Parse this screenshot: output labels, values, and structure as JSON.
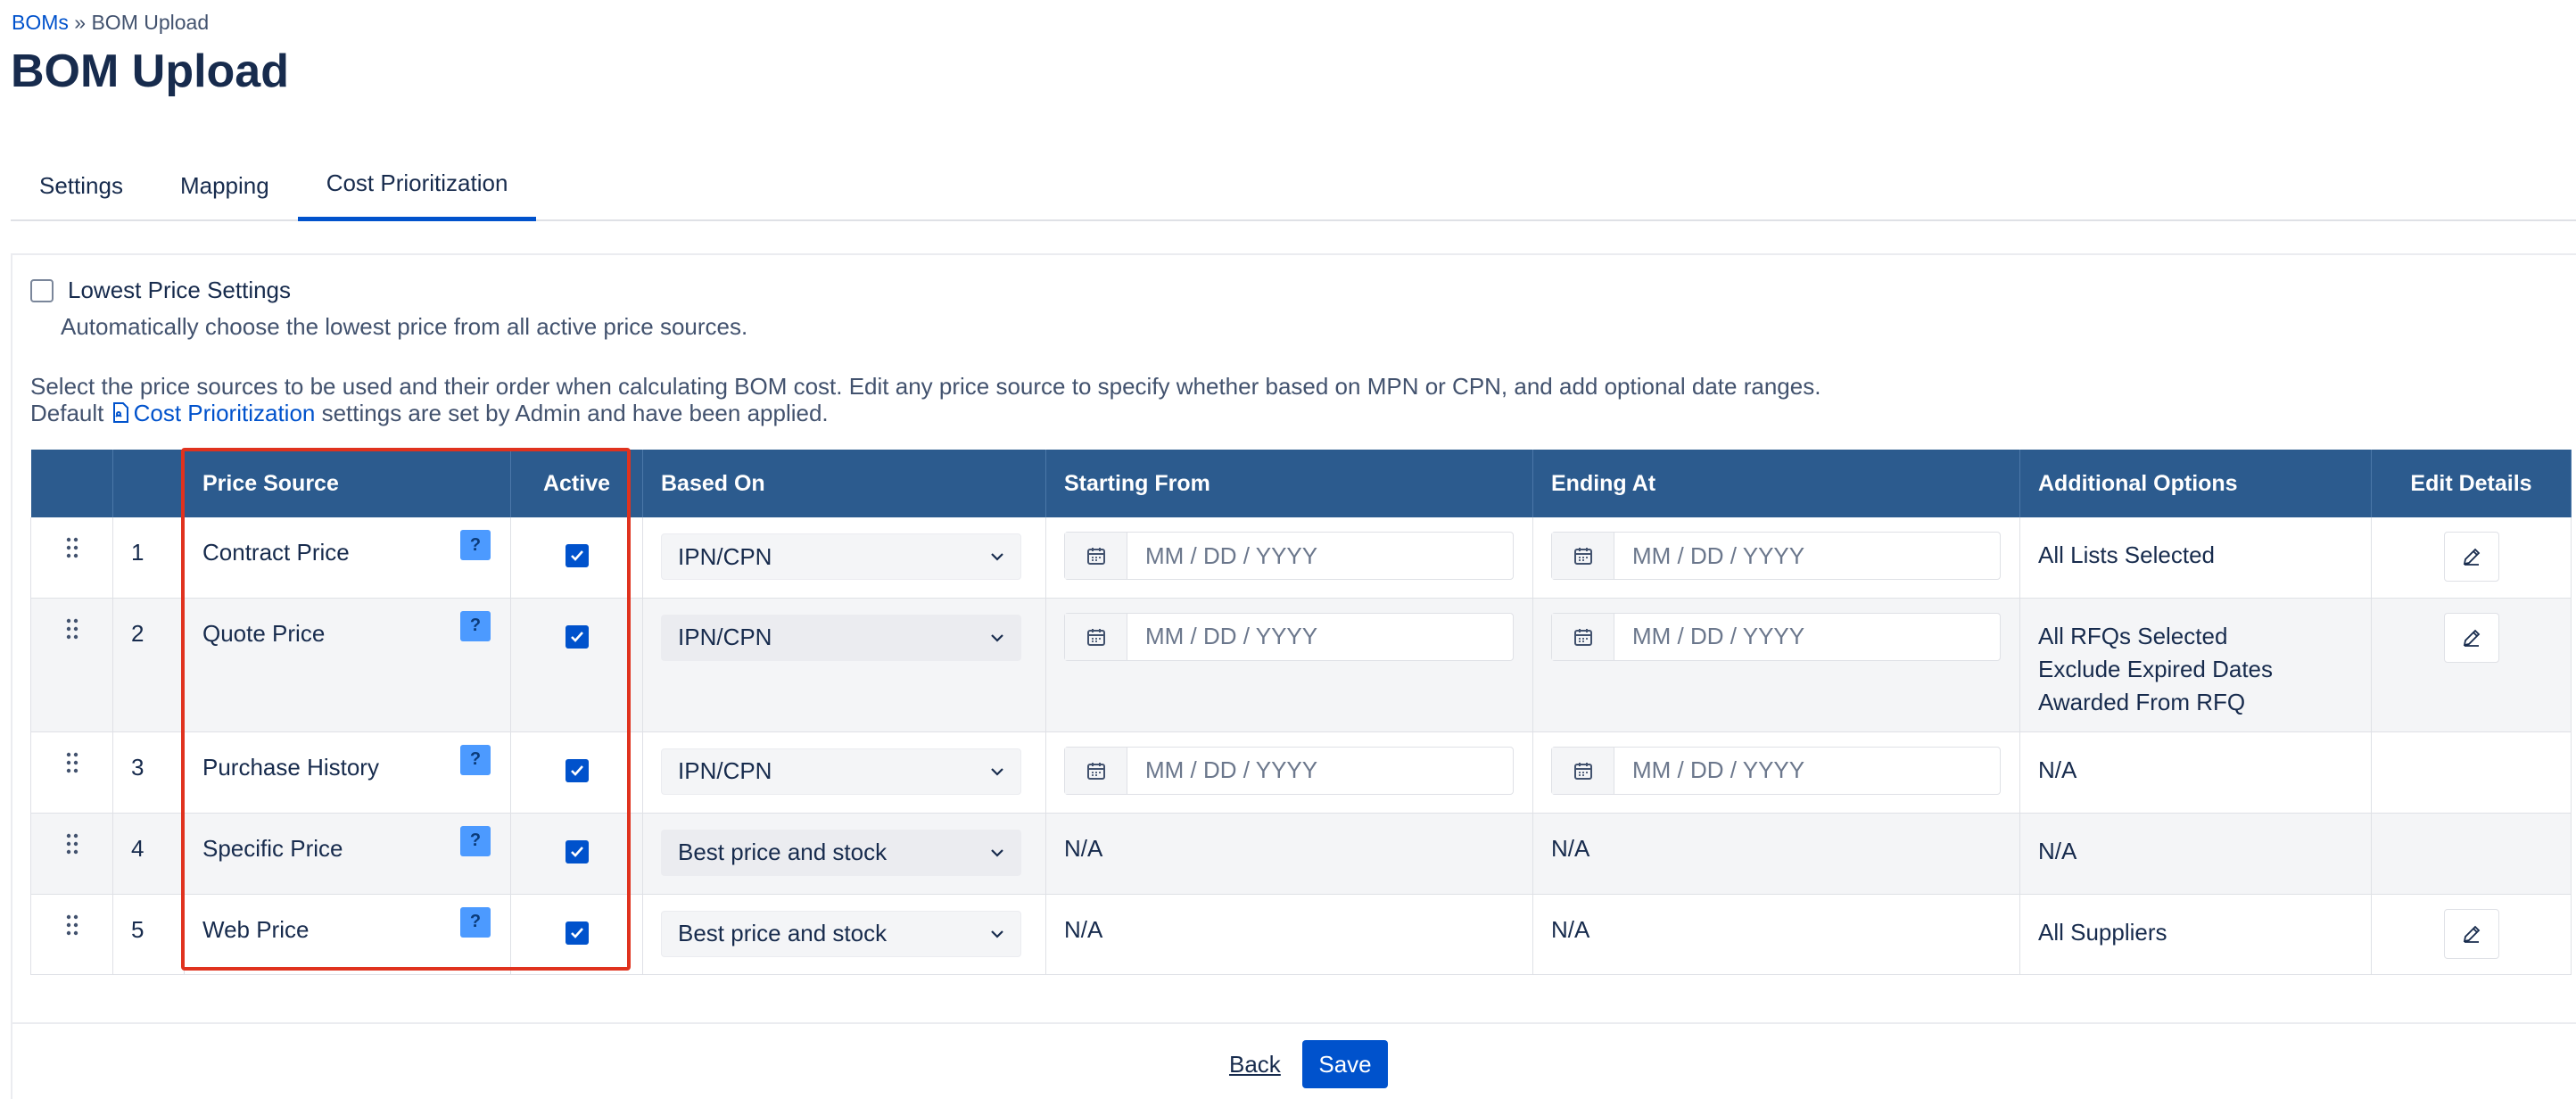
{
  "breadcrumb": {
    "parent": "BOMs",
    "separator": "»",
    "current": "BOM Upload"
  },
  "page_title": "BOM Upload",
  "tabs": [
    {
      "label": "Settings",
      "active": false
    },
    {
      "label": "Mapping",
      "active": false
    },
    {
      "label": "Cost Prioritization",
      "active": true
    }
  ],
  "lowest_price": {
    "label": "Lowest Price Settings",
    "checked": false,
    "description": "Automatically choose the lowest price from all active price sources."
  },
  "instructions": {
    "line1": "Select the price sources to be used and their order when calculating BOM cost. Edit any price source to specify whether based on MPN or CPN, and add optional date ranges.",
    "line2_prefix": "Default",
    "line2_link": "Cost Prioritization",
    "line2_suffix": "settings are set by Admin and have been applied."
  },
  "table": {
    "headers": {
      "price_source": "Price Source",
      "active": "Active",
      "based_on": "Based On",
      "starting_from": "Starting From",
      "ending_at": "Ending At",
      "additional_options": "Additional Options",
      "edit_details": "Edit Details"
    },
    "rows": [
      {
        "num": "1",
        "source": "Contract Price",
        "help": "?",
        "active": true,
        "based_on": "IPN/CPN",
        "start_placeholder": "MM / DD / YYYY",
        "end_placeholder": "MM / DD / YYYY",
        "options": [
          "All Lists Selected"
        ],
        "editable": true
      },
      {
        "num": "2",
        "source": "Quote Price",
        "help": "?",
        "active": true,
        "based_on": "IPN/CPN",
        "start_placeholder": "MM / DD / YYYY",
        "end_placeholder": "MM / DD / YYYY",
        "options": [
          "All RFQs Selected",
          "Exclude Expired Dates",
          "Awarded From RFQ"
        ],
        "editable": true
      },
      {
        "num": "3",
        "source": "Purchase History",
        "help": "?",
        "active": true,
        "based_on": "IPN/CPN",
        "start_placeholder": "MM / DD / YYYY",
        "end_placeholder": "MM / DD / YYYY",
        "options": [
          "N/A"
        ],
        "editable": false
      },
      {
        "num": "4",
        "source": "Specific Price",
        "help": "?",
        "active": true,
        "based_on": "Best price and stock",
        "start_text": "N/A",
        "end_text": "N/A",
        "options": [
          "N/A"
        ],
        "editable": false
      },
      {
        "num": "5",
        "source": "Web Price",
        "help": "?",
        "active": true,
        "based_on": "Best price and stock",
        "start_text": "N/A",
        "end_text": "N/A",
        "options": [
          "All Suppliers"
        ],
        "editable": true
      }
    ]
  },
  "footer": {
    "back_label": "Back",
    "save_label": "Save"
  },
  "colors": {
    "header_bg": "#2c5b8e",
    "accent": "#0052cc",
    "help_badge": "#4c9aff",
    "highlight": "#e0321e"
  }
}
